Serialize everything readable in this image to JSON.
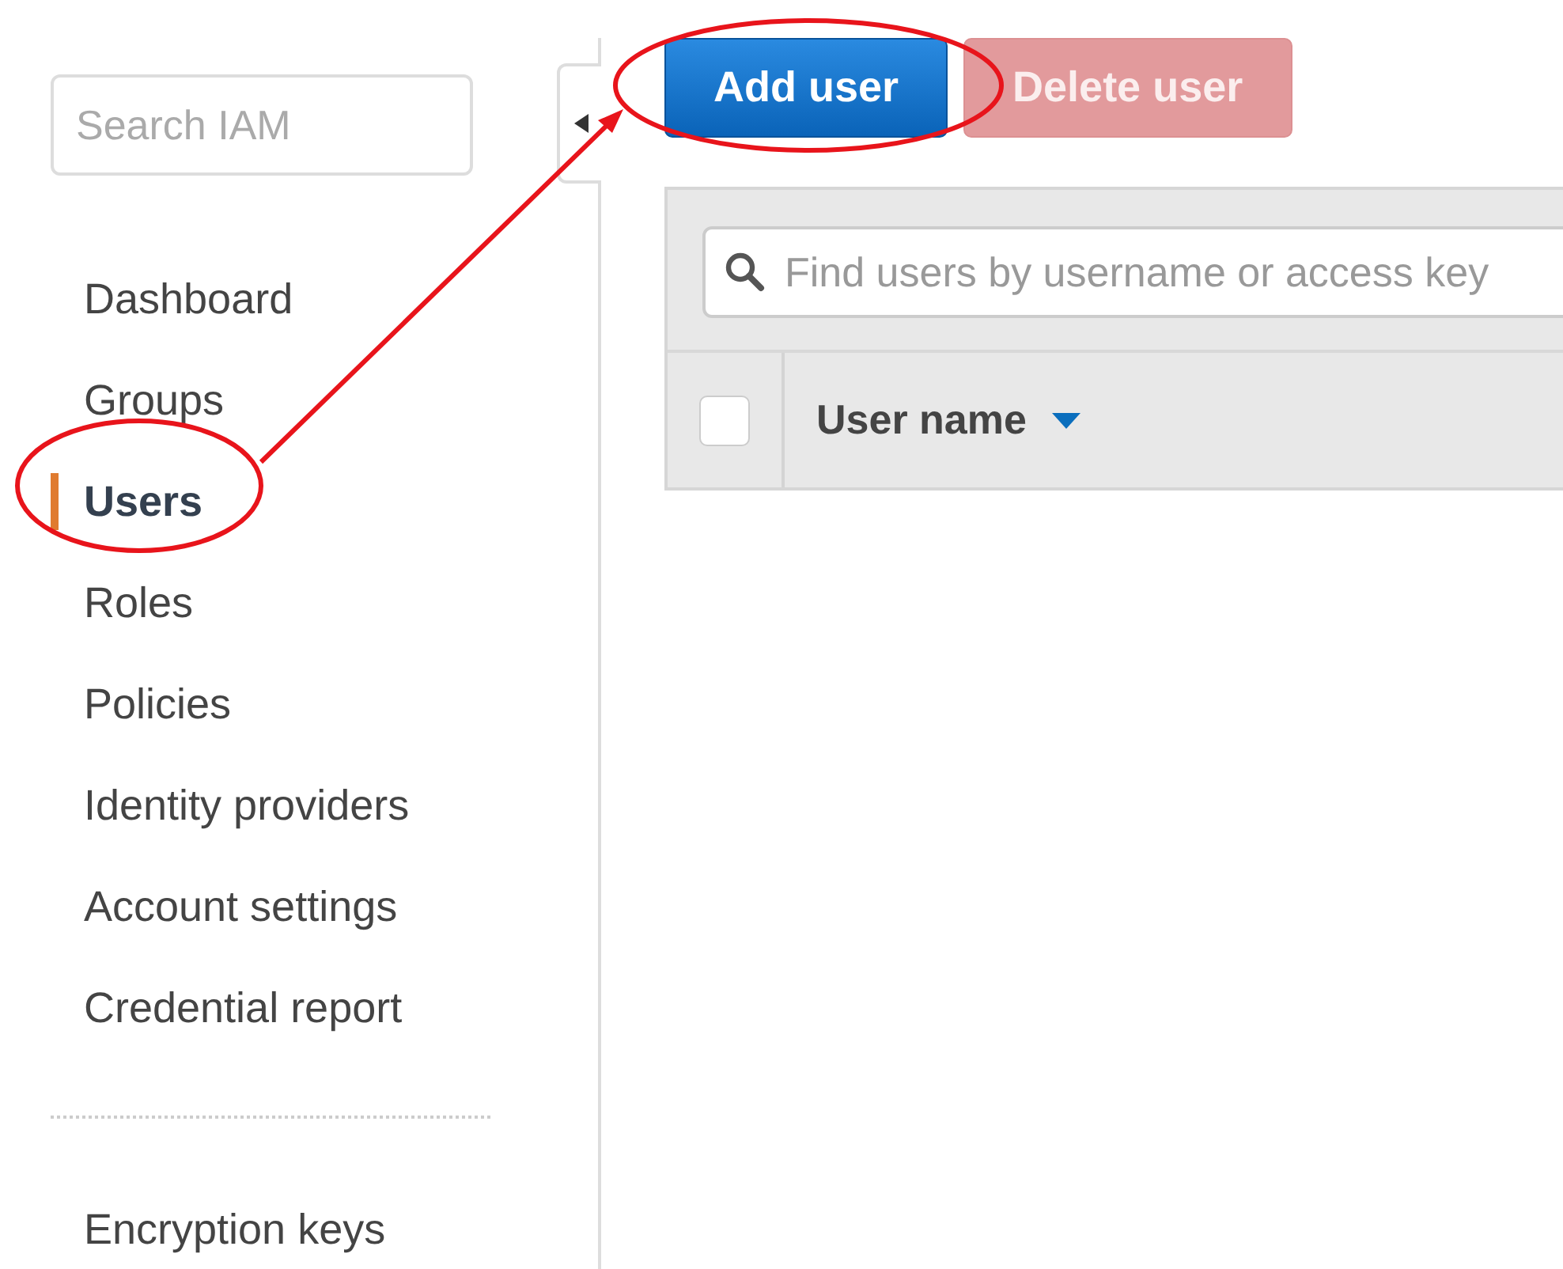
{
  "sidebar": {
    "search": {
      "placeholder": "Search IAM"
    },
    "sections": [
      {
        "items": [
          {
            "label": "Dashboard",
            "selected": false
          },
          {
            "label": "Groups",
            "selected": false
          },
          {
            "label": "Users",
            "selected": true
          },
          {
            "label": "Roles",
            "selected": false
          },
          {
            "label": "Policies",
            "selected": false
          },
          {
            "label": "Identity providers",
            "selected": false
          },
          {
            "label": "Account settings",
            "selected": false
          },
          {
            "label": "Credential report",
            "selected": false
          }
        ]
      },
      {
        "items": [
          {
            "label": "Encryption keys",
            "selected": false
          }
        ]
      }
    ]
  },
  "toolbar": {
    "buttons": [
      {
        "label": "Add user",
        "kind": "primary",
        "disabled": false
      },
      {
        "label": "Delete user",
        "kind": "danger",
        "disabled": true
      }
    ]
  },
  "table": {
    "search": {
      "placeholder": "Find users by username or access key"
    },
    "select_all": {
      "checked": false
    },
    "columns": [
      {
        "label": "User name",
        "sorted": true
      }
    ]
  }
}
